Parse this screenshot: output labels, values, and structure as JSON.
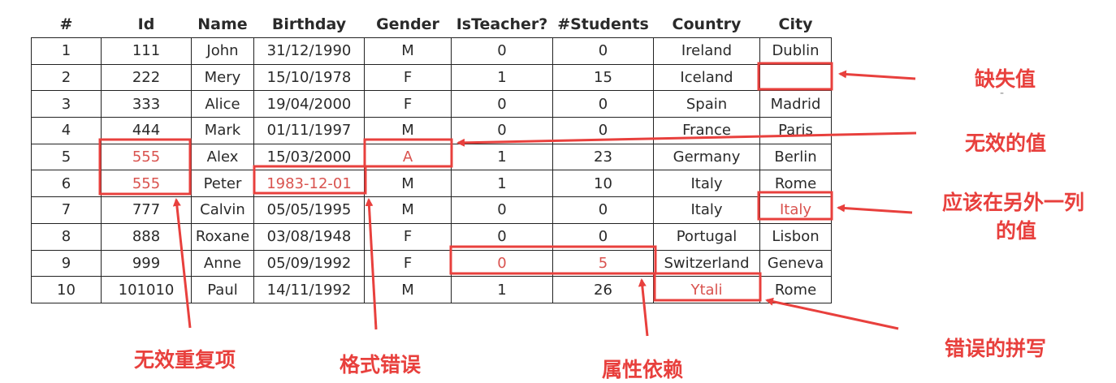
{
  "table": {
    "headers": [
      "#",
      "Id",
      "Name",
      "Birthday",
      "Gender",
      "IsTeacher?",
      "#Students",
      "Country",
      "City"
    ],
    "rows": [
      [
        "1",
        "111",
        "John",
        "31/12/1990",
        "M",
        "0",
        "0",
        "Ireland",
        "Dublin"
      ],
      [
        "2",
        "222",
        "Mery",
        "15/10/1978",
        "F",
        "1",
        "15",
        "Iceland",
        ""
      ],
      [
        "3",
        "333",
        "Alice",
        "19/04/2000",
        "F",
        "0",
        "0",
        "Spain",
        "Madrid"
      ],
      [
        "4",
        "444",
        "Mark",
        "01/11/1997",
        "M",
        "0",
        "0",
        "France",
        "Paris"
      ],
      [
        "5",
        "555",
        "Alex",
        "15/03/2000",
        "A",
        "1",
        "23",
        "Germany",
        "Berlin"
      ],
      [
        "6",
        "555",
        "Peter",
        "1983-12-01",
        "M",
        "1",
        "10",
        "Italy",
        "Rome"
      ],
      [
        "7",
        "777",
        "Calvin",
        "05/05/1995",
        "M",
        "0",
        "0",
        "Italy",
        "Italy"
      ],
      [
        "8",
        "888",
        "Roxane",
        "03/08/1948",
        "F",
        "0",
        "0",
        "Portugal",
        "Lisbon"
      ],
      [
        "9",
        "999",
        "Anne",
        "05/09/1992",
        "F",
        "0",
        "5",
        "Switzerland",
        "Geneva"
      ],
      [
        "10",
        "101010",
        "Paul",
        "14/11/1992",
        "M",
        "1",
        "26",
        "Ytali",
        "Rome"
      ]
    ]
  },
  "annotations": {
    "missing_value": "缺失值",
    "invalid_value": "无效的值",
    "other_column_value_line1": "应该在另外一列",
    "other_column_value_line2": "的值",
    "invalid_duplicate": "无效重复项",
    "format_error": "格式错误",
    "attribute_dependency": "属性依赖",
    "misspelling": "错误的拼写",
    "stray_mark": "-"
  },
  "colors": {
    "highlight": "#e8403d",
    "error_text": "#d9534f",
    "grid": "#222222"
  }
}
